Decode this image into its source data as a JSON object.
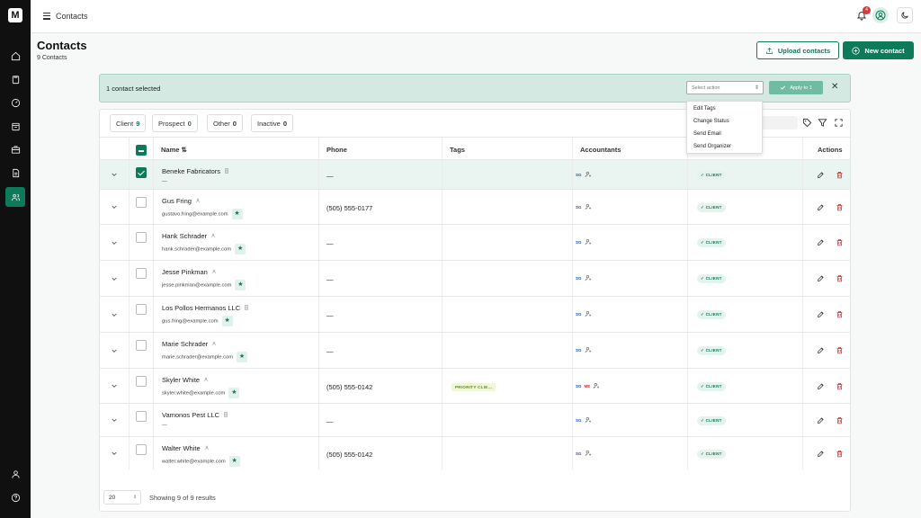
{
  "app": {
    "logo_letter": "M"
  },
  "header": {
    "breadcrumb": "Contacts",
    "notification_count": "4"
  },
  "page": {
    "title": "Contacts",
    "count_label": "9 Contacts",
    "upload_label": "Upload contacts",
    "new_label": "New contact"
  },
  "selection": {
    "text": "1 contact selected",
    "action_placeholder": "Select action",
    "apply_label": "Apply to 1",
    "menu": [
      "Edit Tags",
      "Change Status",
      "Send Email",
      "Send Organizer"
    ]
  },
  "filters": [
    {
      "label": "Client",
      "count": "9"
    },
    {
      "label": "Prospect",
      "count": "0"
    },
    {
      "label": "Other",
      "count": "0"
    },
    {
      "label": "Inactive",
      "count": "0"
    }
  ],
  "columns": {
    "name": "Name",
    "phone": "Phone",
    "tags": "Tags",
    "accountants": "Accountants",
    "actions": "Actions"
  },
  "rows": [
    {
      "name": "Beneke Fabricators",
      "kind": "org",
      "email": "—",
      "phone": "—",
      "tag": "",
      "accountants": [
        "SG"
      ],
      "status": "CLIENT",
      "selected": true,
      "starred": false
    },
    {
      "name": "Gus Fring",
      "kind": "person",
      "email": "gustavo.fring@example.com",
      "phone": "(505) 555-0177",
      "tag": "",
      "accountants": [
        "SG"
      ],
      "status": "CLIENT",
      "selected": false,
      "starred": true
    },
    {
      "name": "Hank Schrader",
      "kind": "person",
      "email": "hank.schrader@example.com",
      "phone": "—",
      "tag": "",
      "accountants": [
        "SG"
      ],
      "status": "CLIENT",
      "selected": false,
      "starred": true
    },
    {
      "name": "Jesse Pinkman",
      "kind": "person",
      "email": "jesse.pinkman@example.com",
      "phone": "—",
      "tag": "",
      "accountants": [
        "SG"
      ],
      "status": "CLIENT",
      "selected": false,
      "starred": true
    },
    {
      "name": "Los Pollos Hermanos LLC",
      "kind": "org",
      "email": "gus.fring@example.com",
      "phone": "—",
      "tag": "",
      "accountants": [
        "SG"
      ],
      "status": "CLIENT",
      "selected": false,
      "starred": true
    },
    {
      "name": "Marie Schrader",
      "kind": "person",
      "email": "marie.schrader@example.com",
      "phone": "—",
      "tag": "",
      "accountants": [
        "SG"
      ],
      "status": "CLIENT",
      "selected": false,
      "starred": true
    },
    {
      "name": "Skyler White",
      "kind": "person",
      "email": "skyler.white@example.com",
      "phone": "(505) 555-0142",
      "tag": "PRIORITY CLIE...",
      "accountants": [
        "SG",
        "ME"
      ],
      "status": "CLIENT",
      "selected": false,
      "starred": true
    },
    {
      "name": "Vamonos Pest LLC",
      "kind": "org",
      "email": "—",
      "phone": "—",
      "tag": "",
      "accountants": [
        "SG"
      ],
      "status": "CLIENT",
      "selected": false,
      "starred": false
    },
    {
      "name": "Walter White",
      "kind": "person",
      "email": "walter.white@example.com",
      "phone": "(505) 555-0142",
      "tag": "",
      "accountants": [
        "SG"
      ],
      "status": "CLIENT",
      "selected": false,
      "starred": true
    }
  ],
  "footer": {
    "page_size": "20",
    "summary": "Showing 9 of 9 results"
  },
  "colors": {
    "brand": "#0d7a5a",
    "sidebar": "#101010",
    "selection_bg": "#d3e9e1",
    "delete": "#c53030",
    "tag_bg": "#eef8d6"
  }
}
